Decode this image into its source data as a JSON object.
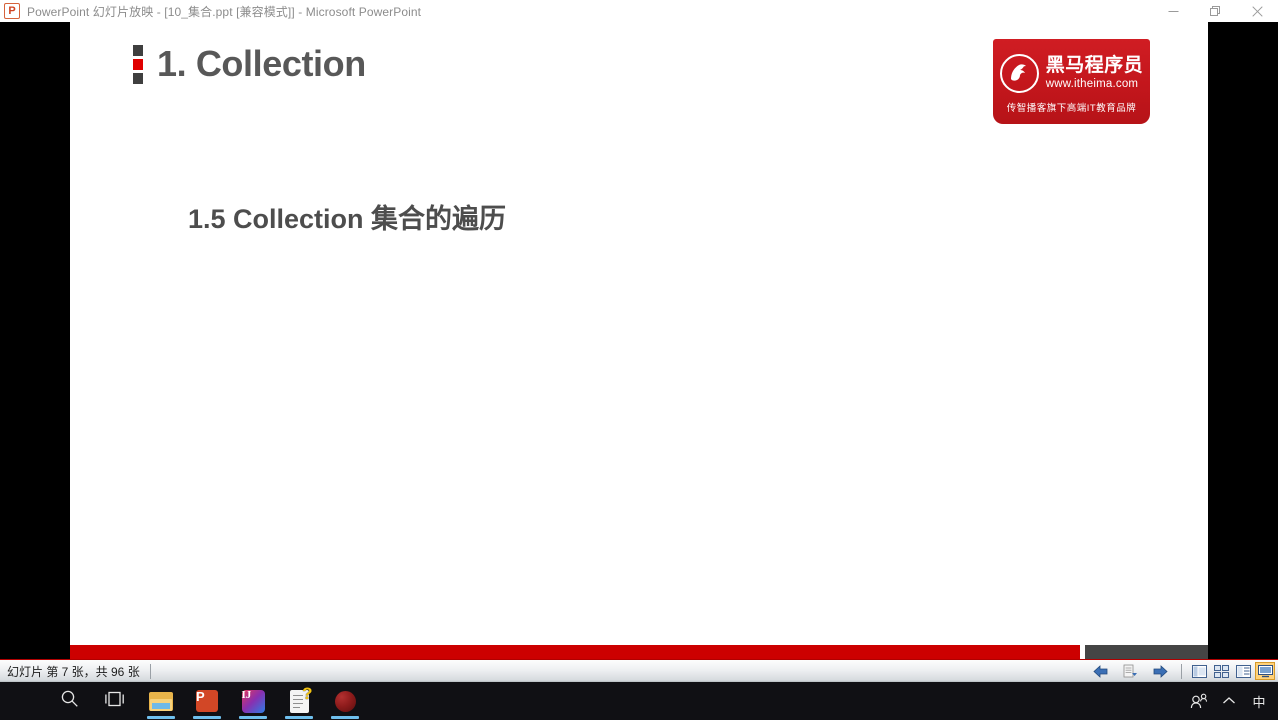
{
  "window": {
    "app_icon": "powerpoint-icon",
    "icon_letter": "P",
    "title": "PowerPoint 幻灯片放映 - [10_集合.ppt [兼容模式]] - Microsoft PowerPoint",
    "controls": {
      "minimize": "minimize-button",
      "restore": "restore-button",
      "close": "close-button"
    }
  },
  "slide": {
    "title": "1. Collection",
    "subtitle": "1.5 Collection 集合的遍历",
    "bullet_colors": [
      "#3f3f3f",
      "#e00000",
      "#3f3f3f"
    ],
    "title_color": "#585858",
    "subtitle_color": "#4d4d4d",
    "accent_red": "#cc0000",
    "accent_gray": "#454545",
    "logo": {
      "mark": "horse-head-icon",
      "brand_cn": "黑马程序员",
      "url": "www.itheima.com",
      "slogan": "传智播客旗下高端IT教育品牌",
      "bg_color": "#c3161c"
    }
  },
  "statusbar": {
    "slide_counter": "幻灯片 第 7 张，共 96 张",
    "nav": [
      {
        "name": "previous-slide-button",
        "icon": "arrow-left-icon"
      },
      {
        "name": "pointer-options-button",
        "icon": "pen-menu-icon"
      },
      {
        "name": "next-slide-button",
        "icon": "arrow-right-icon"
      }
    ],
    "views": [
      {
        "name": "view-normal-button",
        "icon": "normal-view-icon",
        "active": false
      },
      {
        "name": "view-slide-sorter-button",
        "icon": "slide-sorter-icon",
        "active": false
      },
      {
        "name": "view-reading-button",
        "icon": "reading-view-icon",
        "active": false
      },
      {
        "name": "view-slideshow-button",
        "icon": "slideshow-icon",
        "active": true
      }
    ],
    "active_view_highlight": "#ffd27a"
  },
  "taskbar": {
    "items": [
      {
        "name": "start-button",
        "icon": "windows-logo-icon",
        "running": false
      },
      {
        "name": "search-button",
        "icon": "search-icon",
        "running": false
      },
      {
        "name": "task-view-button",
        "icon": "task-view-icon",
        "running": false
      },
      {
        "name": "file-explorer-button",
        "icon": "folder-icon",
        "running": true
      },
      {
        "name": "powerpoint-taskbar-button",
        "icon": "powerpoint-icon",
        "running": true
      },
      {
        "name": "intellij-idea-taskbar-button",
        "icon": "intellij-idea-icon",
        "running": true
      },
      {
        "name": "help-document-taskbar-button",
        "icon": "document-question-icon",
        "running": true
      },
      {
        "name": "recorder-taskbar-button",
        "icon": "red-circle-icon",
        "running": true
      }
    ],
    "tray": [
      {
        "name": "people-tray-icon",
        "icon": "people-icon",
        "label": ""
      },
      {
        "name": "show-hidden-icons-button",
        "icon": "chevron-up-icon",
        "label": ""
      },
      {
        "name": "ime-indicator",
        "icon": "ime-icon",
        "label": "中"
      }
    ],
    "running_indicator_color": "#6fc0ee"
  }
}
